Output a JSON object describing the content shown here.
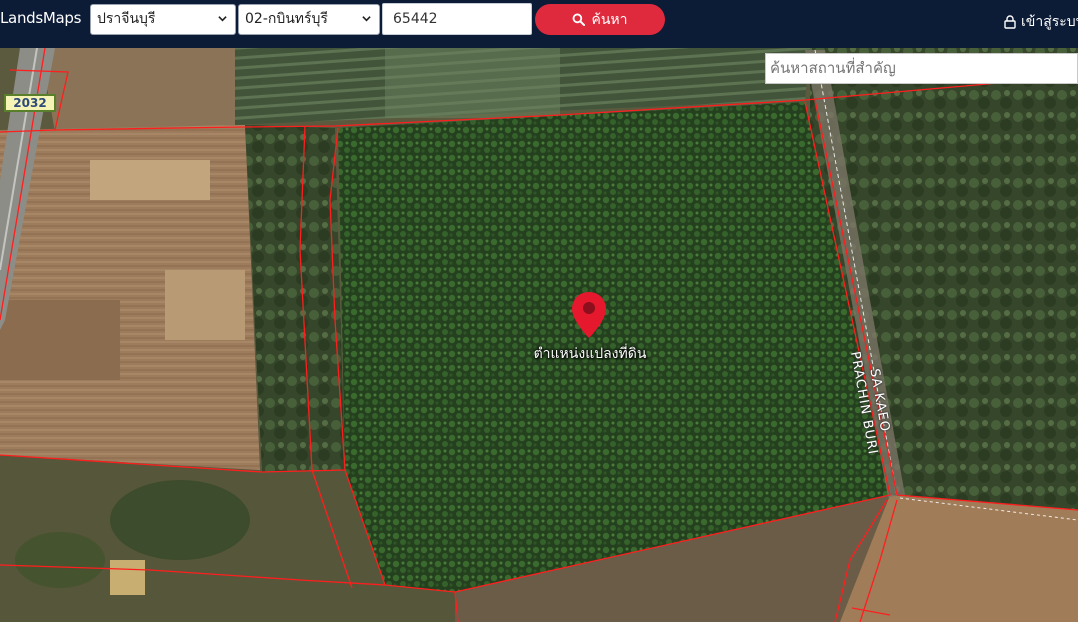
{
  "app": {
    "brand": "LandsMaps"
  },
  "search_bar": {
    "province": "ปราจีนบุรี",
    "district": "02-กบินทร์บุรี",
    "parcel_number": "65442",
    "search_label": "ค้นหา",
    "login_label": "เข้าสู่ระบบ"
  },
  "map": {
    "place_search_placeholder": "ค้นหาสถานที่สำคัญ",
    "road_shield": "2032",
    "marker_label": "ตำแหน่งแปลงที่ดิน",
    "road_label_line1": "SA KAEO",
    "road_label_line2": "PRACHIN BURI",
    "marker_color": "#e5182d",
    "boundary_color": "#ff1e1e"
  },
  "icons": {
    "search": "search-icon",
    "lock": "lock-icon",
    "chevron": "chevron-down-icon",
    "marker": "map-pin-icon"
  }
}
